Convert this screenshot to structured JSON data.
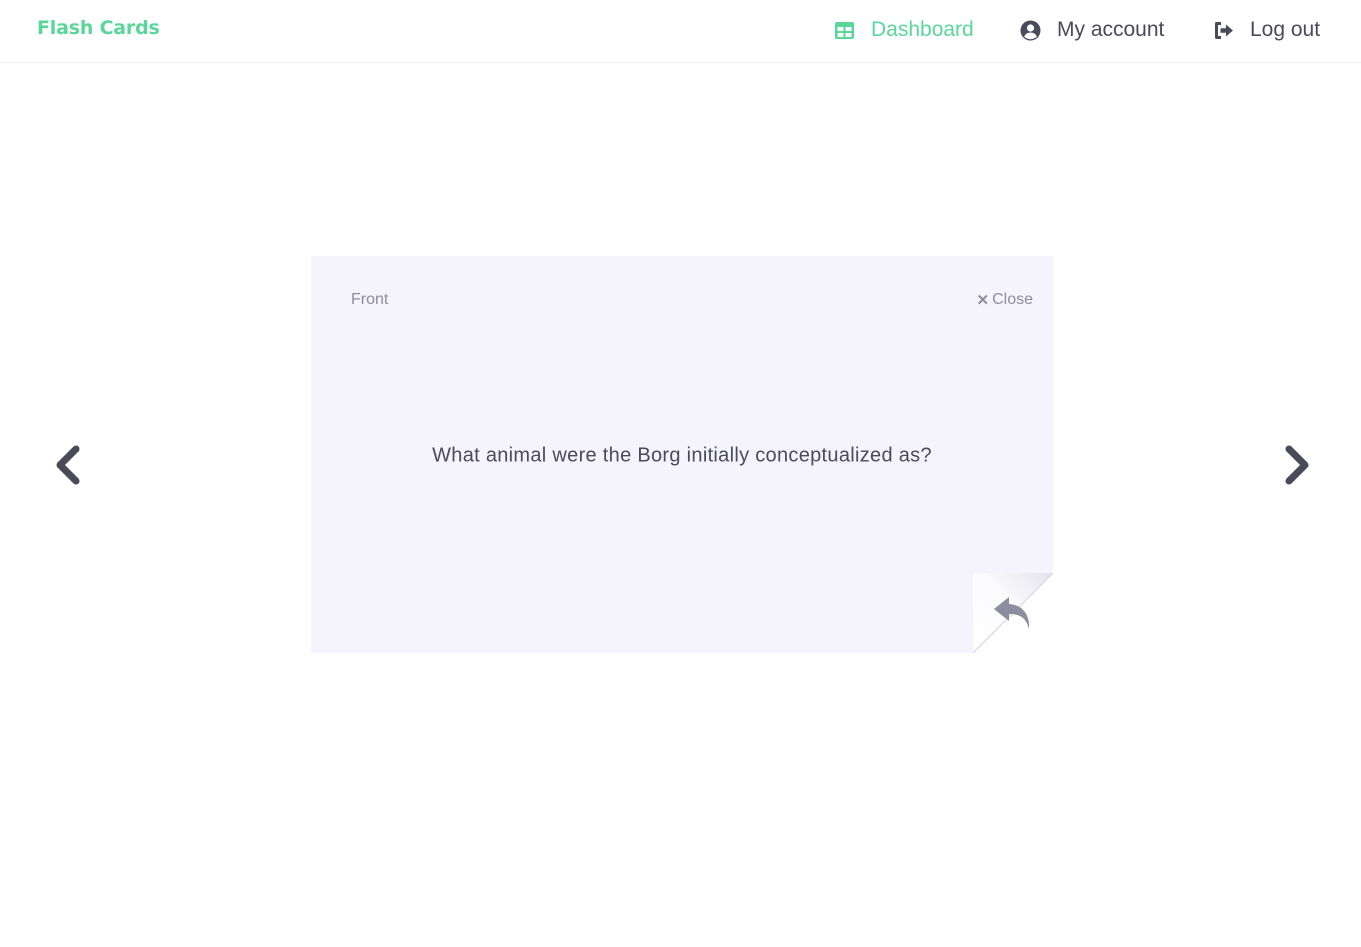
{
  "brand": "Flash Cards",
  "nav": {
    "dashboard": {
      "label": "Dashboard",
      "icon": "table-icon"
    },
    "account": {
      "label": "My account",
      "icon": "user-circle-icon"
    },
    "logout": {
      "label": "Log out",
      "icon": "sign-out-icon"
    }
  },
  "card": {
    "side_label": "Front",
    "close_label": "Close",
    "question": "What animal were the Borg initially conceptualized as?",
    "flip_icon": "reply-icon"
  },
  "navigation": {
    "prev_icon": "chevron-left-icon",
    "next_icon": "chevron-right-icon"
  },
  "colors": {
    "accent": "#5ad69a",
    "text": "#4a4a5a",
    "muted": "#8e8c9f",
    "card_bg": "#f5f4fd"
  }
}
